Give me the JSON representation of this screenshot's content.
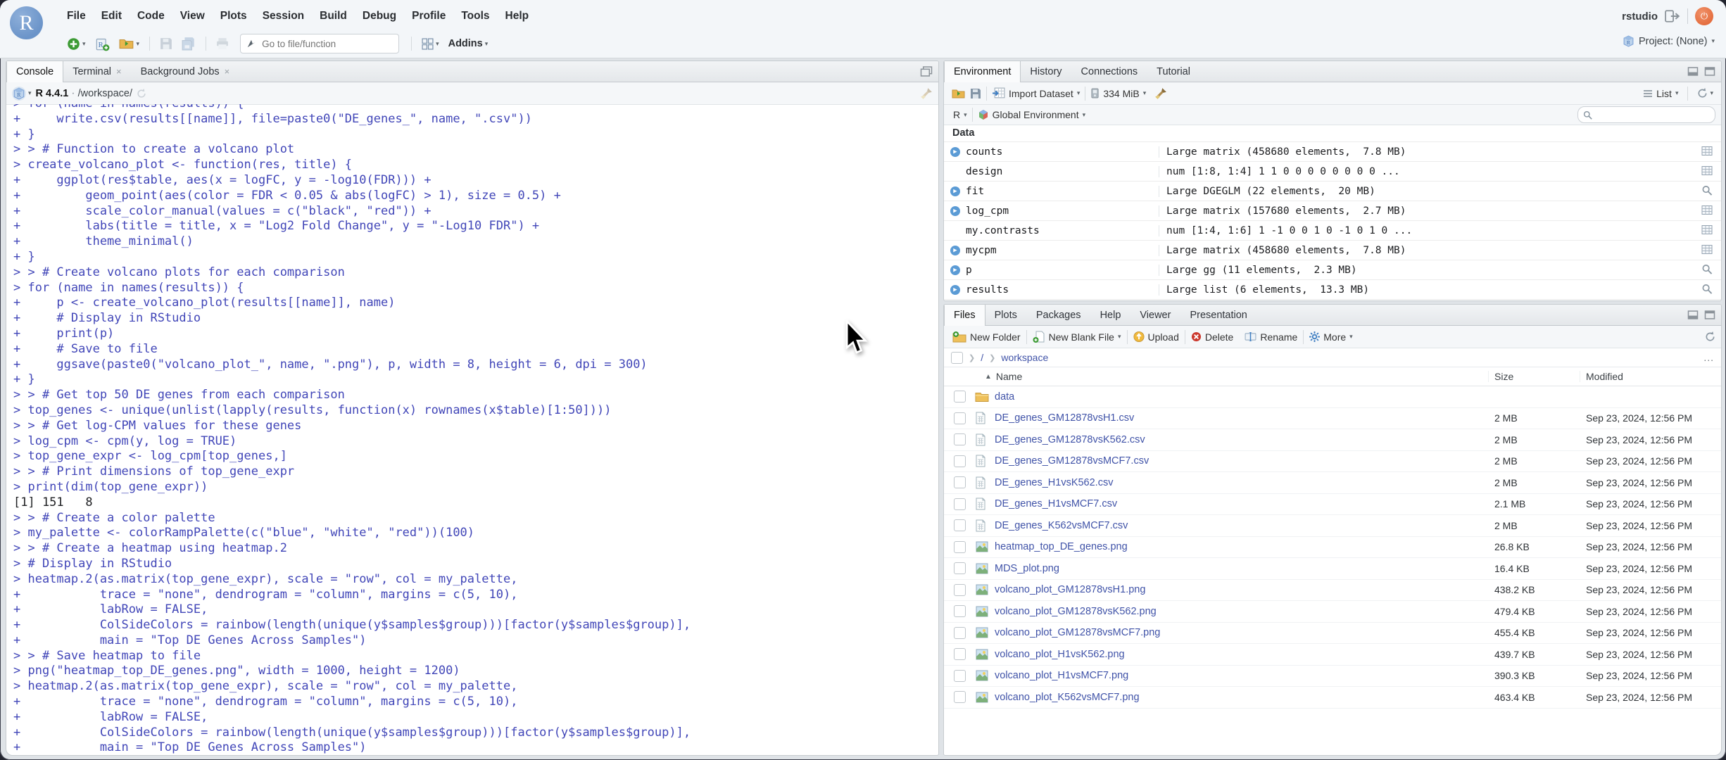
{
  "window": {
    "user_label": "rstudio",
    "project_label": "Project: (None)"
  },
  "menubar": {
    "items": [
      "File",
      "Edit",
      "Code",
      "View",
      "Plots",
      "Session",
      "Build",
      "Debug",
      "Profile",
      "Tools",
      "Help"
    ]
  },
  "toolbar": {
    "goto_placeholder": "Go to file/function",
    "addins_label": "Addins"
  },
  "console_pane": {
    "tabs": [
      {
        "label": "Console",
        "active": true,
        "closable": false
      },
      {
        "label": "Terminal",
        "active": false,
        "closable": true
      },
      {
        "label": "Background Jobs",
        "active": false,
        "closable": true
      }
    ],
    "r_version": "R 4.4.1",
    "separator": "·",
    "cwd": "/workspace/",
    "lines": [
      {
        "k": "in",
        "t": "> for (name in names(results)) {"
      },
      {
        "k": "in",
        "t": "+     write.csv(results[[name]], file=paste0(\"DE_genes_\", name, \".csv\"))"
      },
      {
        "k": "in",
        "t": "+ }"
      },
      {
        "k": "in",
        "t": "> > # Function to create a volcano plot"
      },
      {
        "k": "in",
        "t": "> create_volcano_plot <- function(res, title) {"
      },
      {
        "k": "in",
        "t": "+     ggplot(res$table, aes(x = logFC, y = -log10(FDR))) +"
      },
      {
        "k": "in",
        "t": "+         geom_point(aes(color = FDR < 0.05 & abs(logFC) > 1), size = 0.5) +"
      },
      {
        "k": "in",
        "t": "+         scale_color_manual(values = c(\"black\", \"red\")) +"
      },
      {
        "k": "in",
        "t": "+         labs(title = title, x = \"Log2 Fold Change\", y = \"-Log10 FDR\") +"
      },
      {
        "k": "in",
        "t": "+         theme_minimal()"
      },
      {
        "k": "in",
        "t": "+ }"
      },
      {
        "k": "in",
        "t": "> > # Create volcano plots for each comparison"
      },
      {
        "k": "in",
        "t": "> for (name in names(results)) {"
      },
      {
        "k": "in",
        "t": "+     p <- create_volcano_plot(results[[name]], name)"
      },
      {
        "k": "in",
        "t": "+     # Display in RStudio"
      },
      {
        "k": "in",
        "t": "+     print(p)"
      },
      {
        "k": "in",
        "t": "+     # Save to file"
      },
      {
        "k": "in",
        "t": "+     ggsave(paste0(\"volcano_plot_\", name, \".png\"), p, width = 8, height = 6, dpi = 300)"
      },
      {
        "k": "in",
        "t": "+ }"
      },
      {
        "k": "in",
        "t": "> > # Get top 50 DE genes from each comparison"
      },
      {
        "k": "in",
        "t": "> top_genes <- unique(unlist(lapply(results, function(x) rownames(x$table)[1:50])))"
      },
      {
        "k": "in",
        "t": "> > # Get log-CPM values for these genes"
      },
      {
        "k": "in",
        "t": "> log_cpm <- cpm(y, log = TRUE)"
      },
      {
        "k": "in",
        "t": "> top_gene_expr <- log_cpm[top_genes,]"
      },
      {
        "k": "in",
        "t": "> > # Print dimensions of top_gene_expr"
      },
      {
        "k": "in",
        "t": "> print(dim(top_gene_expr))"
      },
      {
        "k": "out",
        "t": "[1] 151   8"
      },
      {
        "k": "in",
        "t": "> > # Create a color palette"
      },
      {
        "k": "in",
        "t": "> my_palette <- colorRampPalette(c(\"blue\", \"white\", \"red\"))(100)"
      },
      {
        "k": "in",
        "t": "> > # Create a heatmap using heatmap.2"
      },
      {
        "k": "in",
        "t": "> # Display in RStudio"
      },
      {
        "k": "in",
        "t": "> heatmap.2(as.matrix(top_gene_expr), scale = \"row\", col = my_palette,"
      },
      {
        "k": "in",
        "t": "+           trace = \"none\", dendrogram = \"column\", margins = c(5, 10),"
      },
      {
        "k": "in",
        "t": "+           labRow = FALSE,"
      },
      {
        "k": "in",
        "t": "+           ColSideColors = rainbow(length(unique(y$samples$group)))[factor(y$samples$group)],"
      },
      {
        "k": "in",
        "t": "+           main = \"Top DE Genes Across Samples\")"
      },
      {
        "k": "in",
        "t": "> > # Save heatmap to file"
      },
      {
        "k": "in",
        "t": "> png(\"heatmap_top_DE_genes.png\", width = 1000, height = 1200)"
      },
      {
        "k": "in",
        "t": "> heatmap.2(as.matrix(top_gene_expr), scale = \"row\", col = my_palette,"
      },
      {
        "k": "in",
        "t": "+           trace = \"none\", dendrogram = \"column\", margins = c(5, 10),"
      },
      {
        "k": "in",
        "t": "+           labRow = FALSE,"
      },
      {
        "k": "in",
        "t": "+           ColSideColors = rainbow(length(unique(y$samples$group)))[factor(y$samples$group)],"
      },
      {
        "k": "in",
        "t": "+           main = \"Top DE Genes Across Samples\")"
      }
    ]
  },
  "environment_pane": {
    "tabs": [
      {
        "label": "Environment",
        "active": true
      },
      {
        "label": "History",
        "active": false
      },
      {
        "label": "Connections",
        "active": false
      },
      {
        "label": "Tutorial",
        "active": false
      }
    ],
    "toolbar": {
      "import_label": "Import Dataset",
      "memory_label": "334 MiB",
      "list_label": "List"
    },
    "scope": {
      "r_label": "R",
      "env_label": "Global Environment"
    },
    "section_label": "Data",
    "objects": [
      {
        "name": "counts",
        "value": "Large matrix (458680 elements,  7.8 MB)",
        "expandable": true,
        "action": "grid"
      },
      {
        "name": "design",
        "value": "num [1:8, 1:4] 1 1 0 0 0 0 0 0 0 0 ...",
        "expandable": false,
        "action": "grid"
      },
      {
        "name": "fit",
        "value": "Large DGEGLM (22 elements,  20 MB)",
        "expandable": true,
        "action": "search"
      },
      {
        "name": "log_cpm",
        "value": "Large matrix (157680 elements,  2.7 MB)",
        "expandable": true,
        "action": "grid"
      },
      {
        "name": "my.contrasts",
        "value": "num [1:4, 1:6] 1 -1 0 0 1 0 -1 0 1 0 ...",
        "expandable": false,
        "action": "grid"
      },
      {
        "name": "mycpm",
        "value": "Large matrix (458680 elements,  7.8 MB)",
        "expandable": true,
        "action": "grid"
      },
      {
        "name": "p",
        "value": "Large gg (11 elements,  2.3 MB)",
        "expandable": true,
        "action": "search"
      },
      {
        "name": "results",
        "value": "Large list (6 elements,  13.3 MB)",
        "expandable": true,
        "action": "search"
      }
    ]
  },
  "files_pane": {
    "tabs": [
      {
        "label": "Files",
        "active": true
      },
      {
        "label": "Plots",
        "active": false
      },
      {
        "label": "Packages",
        "active": false
      },
      {
        "label": "Help",
        "active": false
      },
      {
        "label": "Viewer",
        "active": false
      },
      {
        "label": "Presentation",
        "active": false
      }
    ],
    "toolbar": {
      "new_folder": "New Folder",
      "new_blank_file": "New Blank File",
      "upload": "Upload",
      "delete": "Delete",
      "rename": "Rename",
      "more": "More"
    },
    "breadcrumb": {
      "root": "/",
      "path": "workspace",
      "overflow": "..."
    },
    "columns": {
      "name": "Name",
      "size": "Size",
      "modified": "Modified"
    },
    "files": [
      {
        "name": "data",
        "type": "folder",
        "size": "",
        "modified": ""
      },
      {
        "name": "DE_genes_GM12878vsH1.csv",
        "type": "csv",
        "size": "2 MB",
        "modified": "Sep 23, 2024, 12:56 PM"
      },
      {
        "name": "DE_genes_GM12878vsK562.csv",
        "type": "csv",
        "size": "2 MB",
        "modified": "Sep 23, 2024, 12:56 PM"
      },
      {
        "name": "DE_genes_GM12878vsMCF7.csv",
        "type": "csv",
        "size": "2 MB",
        "modified": "Sep 23, 2024, 12:56 PM"
      },
      {
        "name": "DE_genes_H1vsK562.csv",
        "type": "csv",
        "size": "2 MB",
        "modified": "Sep 23, 2024, 12:56 PM"
      },
      {
        "name": "DE_genes_H1vsMCF7.csv",
        "type": "csv",
        "size": "2.1 MB",
        "modified": "Sep 23, 2024, 12:56 PM"
      },
      {
        "name": "DE_genes_K562vsMCF7.csv",
        "type": "csv",
        "size": "2 MB",
        "modified": "Sep 23, 2024, 12:56 PM"
      },
      {
        "name": "heatmap_top_DE_genes.png",
        "type": "png",
        "size": "26.8 KB",
        "modified": "Sep 23, 2024, 12:56 PM"
      },
      {
        "name": "MDS_plot.png",
        "type": "png",
        "size": "16.4 KB",
        "modified": "Sep 23, 2024, 12:56 PM"
      },
      {
        "name": "volcano_plot_GM12878vsH1.png",
        "type": "png",
        "size": "438.2 KB",
        "modified": "Sep 23, 2024, 12:56 PM"
      },
      {
        "name": "volcano_plot_GM12878vsK562.png",
        "type": "png",
        "size": "479.4 KB",
        "modified": "Sep 23, 2024, 12:56 PM"
      },
      {
        "name": "volcano_plot_GM12878vsMCF7.png",
        "type": "png",
        "size": "455.4 KB",
        "modified": "Sep 23, 2024, 12:56 PM"
      },
      {
        "name": "volcano_plot_H1vsK562.png",
        "type": "png",
        "size": "439.7 KB",
        "modified": "Sep 23, 2024, 12:56 PM"
      },
      {
        "name": "volcano_plot_H1vsMCF7.png",
        "type": "png",
        "size": "390.3 KB",
        "modified": "Sep 23, 2024, 12:56 PM"
      },
      {
        "name": "volcano_plot_K562vsMCF7.png",
        "type": "png",
        "size": "463.4 KB",
        "modified": "Sep 23, 2024, 12:56 PM"
      }
    ]
  },
  "colors": {
    "console_text": "#4146b8",
    "link": "#4053a8",
    "folder": "#e9b64e",
    "logo": "#6b94c9",
    "accent_blue": "#5b9bd5"
  }
}
